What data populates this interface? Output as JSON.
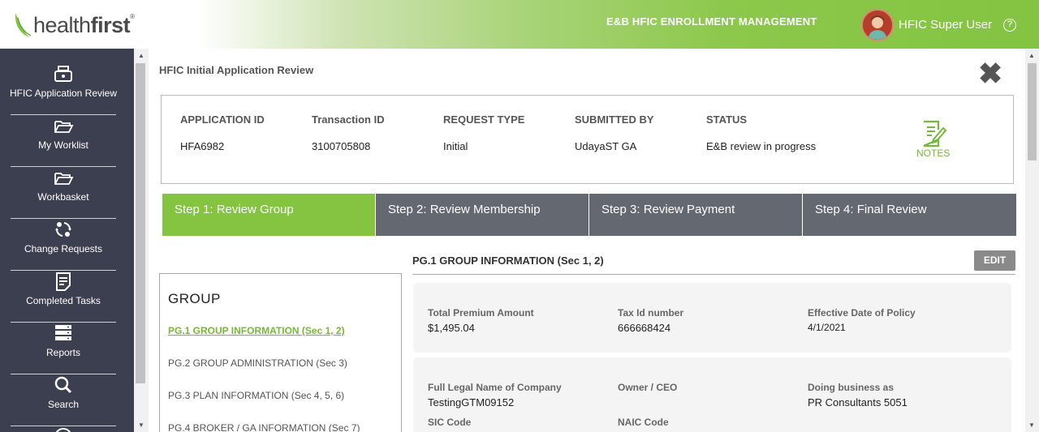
{
  "header": {
    "logo_regular": "health",
    "logo_bold": "first",
    "app_title": "E&B HFIC ENROLLMENT MANAGEMENT",
    "user_name": "HFIC Super User",
    "help_glyph": "?"
  },
  "sidebar": {
    "items": [
      {
        "label": "HFIC Application Review",
        "icon": "cash-register-icon"
      },
      {
        "label": "My Worklist",
        "icon": "folder-open-icon"
      },
      {
        "label": "Workbasket",
        "icon": "folder-open-icon"
      },
      {
        "label": "Change Requests",
        "icon": "exchange-icon"
      },
      {
        "label": "Completed Tasks",
        "icon": "clipboard-list-icon"
      },
      {
        "label": "Reports",
        "icon": "reports-icon"
      },
      {
        "label": "Search",
        "icon": "search-icon"
      }
    ]
  },
  "page": {
    "title": "HFIC Initial Application Review",
    "close_glyph": "✖"
  },
  "summary": {
    "columns": [
      {
        "header": "APPLICATION ID",
        "value": "HFA6982"
      },
      {
        "header": "Transaction ID",
        "value": "3100705808"
      },
      {
        "header": "REQUEST TYPE",
        "value": "Initial"
      },
      {
        "header": "SUBMITTED BY",
        "value": "UdayaST GA"
      },
      {
        "header": "STATUS",
        "value": "E&B review in progress"
      }
    ],
    "notes_label": "NOTES"
  },
  "steps": [
    {
      "label": "Step 1: Review Group",
      "active": true
    },
    {
      "label": "Step 2: Review Membership",
      "active": false
    },
    {
      "label": "Step 3: Review Payment",
      "active": false
    },
    {
      "label": "Step 4: Final Review",
      "active": false
    }
  ],
  "group_nav": {
    "heading": "GROUP",
    "links": [
      "PG.1 GROUP INFORMATION (Sec 1, 2)",
      "PG.2 GROUP ADMINISTRATION (Sec 3)",
      "PG.3 PLAN INFORMATION (Sec 4, 5, 6)",
      "PG.4 BROKER / GA INFORMATION (Sec 7)"
    ]
  },
  "section": {
    "title": "PG.1 GROUP INFORMATION (Sec 1, 2)",
    "edit_label": "EDIT",
    "card1": {
      "total_premium_label": "Total Premium Amount",
      "total_premium_value": "$1,495.04",
      "tax_id_label": "Tax Id number",
      "tax_id_value": "666668424",
      "effective_date_label": "Effective Date of Policy",
      "effective_date_value": "4/1/2021"
    },
    "card2": {
      "legal_name_label": "Full Legal Name of Company",
      "legal_name_value": "TestingGTM09152",
      "owner_label": "Owner / CEO",
      "owner_value": "",
      "dba_label": "Doing business as",
      "dba_value": "PR Consultants 5051",
      "sic_label": "SIC Code",
      "naic_label": "NAIC Code"
    }
  },
  "colors": {
    "brand_green": "#84c441",
    "sidebar_bg": "#3b3f4f",
    "step_inactive": "#636871"
  }
}
